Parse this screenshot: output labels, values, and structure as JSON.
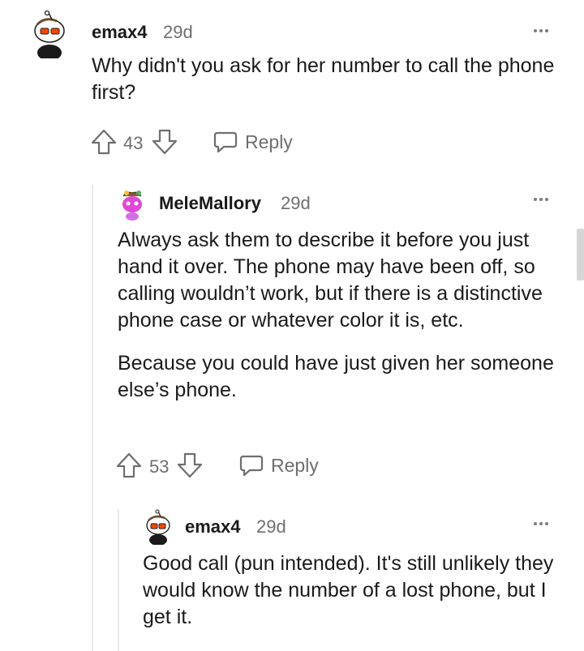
{
  "comments": [
    {
      "username": "emax4",
      "time": "29d",
      "body": [
        "Why didn't you ask for her number to call the phone first?"
      ],
      "score": "43",
      "reply_label": "Reply"
    },
    {
      "username": "MeleMallory",
      "time": "29d",
      "body": [
        "Always ask them to describe it before you just hand it over. The phone may have been off, so calling wouldn’t work, but if there is a distinctive phone case or whatever color it is, etc.",
        "Because you could have just given her someone else’s phone."
      ],
      "score": "53",
      "reply_label": "Reply"
    },
    {
      "username": "emax4",
      "time": "29d",
      "body": [
        "Good call (pun intended). It's still unlikely they would know the number of a lost phone, but I get it."
      ]
    }
  ],
  "icons": {
    "upvote": "arrow-up-outline-icon",
    "downvote": "arrow-down-outline-icon",
    "reply": "speech-bubble-icon",
    "more": "three-dots-icon"
  },
  "colors": {
    "text": "#1a1a1b",
    "meta": "#6e6e70",
    "thread_line": "#e9e9e9"
  }
}
